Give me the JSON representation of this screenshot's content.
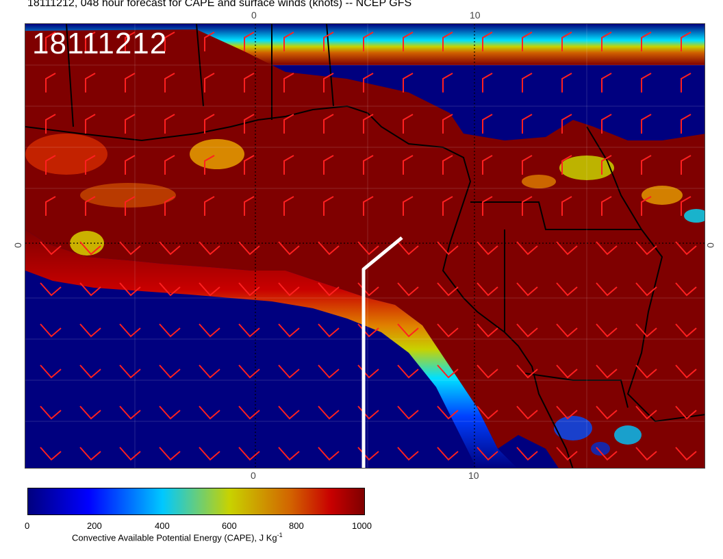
{
  "title": "18111212, 048 hour forecast for CAPE and surface winds (knots) -- NCEP GFS",
  "datestamp": "18111212",
  "axes": {
    "top_ticks": [
      "0",
      "10"
    ],
    "bottom_ticks": [
      "0",
      "10"
    ],
    "left_ticks": [
      "0"
    ],
    "right_ticks": [
      "0"
    ]
  },
  "colorbar": {
    "ticks": [
      "0",
      "200",
      "400",
      "600",
      "800",
      "1000"
    ],
    "label": "Convective Available Potential Energy (CAPE), J Kg",
    "label_superscript": "-1",
    "range": [
      0,
      1000
    ],
    "colors": [
      "#00007f",
      "#0000ff",
      "#00c8ff",
      "#c8d200",
      "#d26400",
      "#c80000",
      "#7f0000"
    ]
  },
  "palette": {
    "low_cape": "#00007f",
    "high_cape": "#7f0000",
    "wind_barbs": "#ff2020",
    "coastline": "#000000",
    "track": "#ffffff"
  }
}
